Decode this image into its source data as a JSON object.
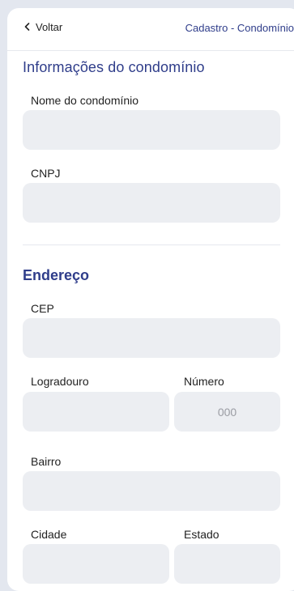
{
  "header": {
    "back_label": "Voltar",
    "title": "Cadastro - Condomínio"
  },
  "sections": {
    "info_title": "Informações do condomínio",
    "address_title": "Endereço"
  },
  "fields": {
    "nome": {
      "label": "Nome do condomínio",
      "value": "",
      "placeholder": ""
    },
    "cnpj": {
      "label": "CNPJ",
      "value": "",
      "placeholder": ""
    },
    "cep": {
      "label": "CEP",
      "value": "",
      "placeholder": ""
    },
    "logradouro": {
      "label": "Logradouro",
      "value": "",
      "placeholder": ""
    },
    "numero": {
      "label": "Número",
      "value": "",
      "placeholder": "000"
    },
    "bairro": {
      "label": "Bairro",
      "value": "",
      "placeholder": ""
    },
    "cidade": {
      "label": "Cidade",
      "value": "",
      "placeholder": ""
    },
    "estado": {
      "label": "Estado",
      "value": "",
      "placeholder": ""
    }
  },
  "colors": {
    "accent": "#2f3d8a",
    "field_bg": "#eceef2",
    "page_bg": "#e3e7ef"
  },
  "icons": {
    "back": "chevron-left-icon"
  }
}
